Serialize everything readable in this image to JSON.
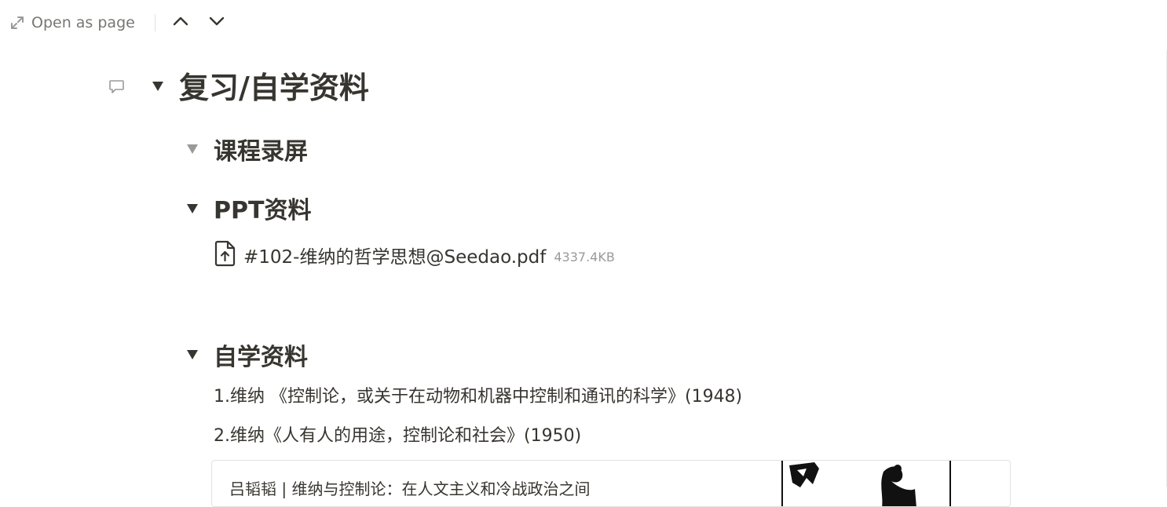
{
  "topbar": {
    "open_as_page_label": "Open as page",
    "icons": {
      "open": "expand-arrows-icon",
      "previous": "chevron-up-icon",
      "next": "chevron-down-icon"
    }
  },
  "page": {
    "heading": "复习/自学资料",
    "sections": {
      "recordings": {
        "title": "课程录屏",
        "expanded": false
      },
      "ppt": {
        "title": "PPT资料",
        "file": {
          "icon": "file-upload-icon",
          "name": "#102-维纳的哲学思想@Seedao.pdf",
          "size": "4337.4KB"
        }
      },
      "self_study": {
        "title": "自学资料",
        "items": [
          "1.维纳 《控制论，或关于在动物和机器中控制和通讯的科学》(1948)",
          "2.维纳《人有人的用途，控制论和社会》(1950)"
        ],
        "bookmark": {
          "title": "吕韬韬 | 维纳与控制论：在人文主义和冷战政治之间"
        }
      }
    }
  },
  "colors": {
    "text": "#37352f",
    "muted": "#787774",
    "border": "#e3e2e0"
  }
}
